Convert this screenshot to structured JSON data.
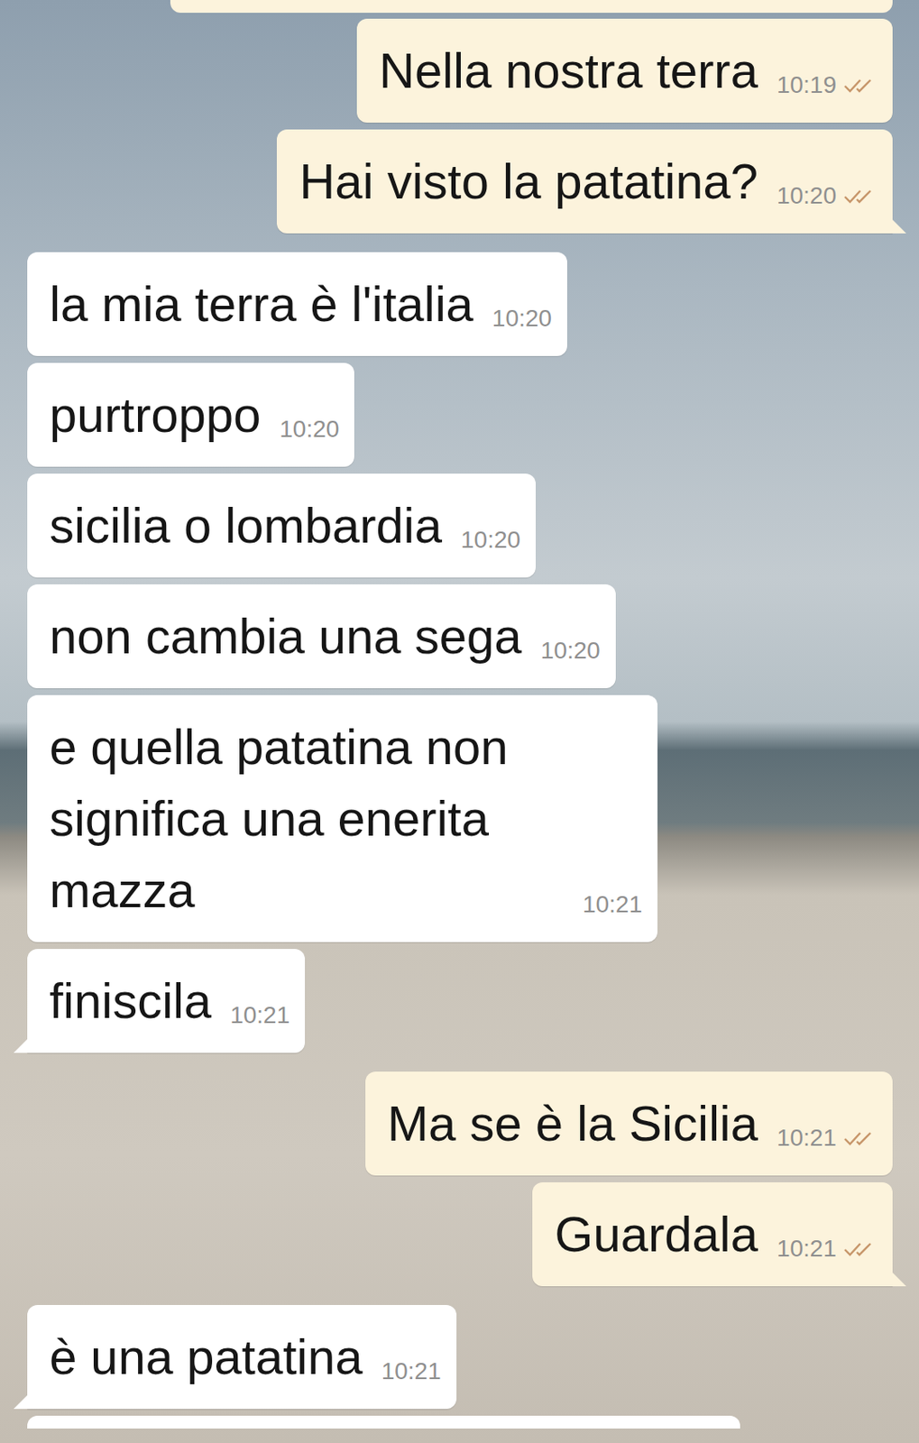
{
  "chat": {
    "messages": [
      {
        "from": "me",
        "text": "Nella nostra terra",
        "time": "10:19",
        "status": "delivered"
      },
      {
        "from": "me",
        "text": "Hai visto la patatina?",
        "time": "10:20",
        "status": "delivered"
      },
      {
        "from": "them",
        "text": "la mia terra è l'italia",
        "time": "10:20"
      },
      {
        "from": "them",
        "text": "purtroppo",
        "time": "10:20"
      },
      {
        "from": "them",
        "text": "sicilia o lombardia",
        "time": "10:20"
      },
      {
        "from": "them",
        "text": "non cambia una sega",
        "time": "10:20"
      },
      {
        "from": "them",
        "text": "e quella patatina non significa una enerita mazza",
        "time": "10:21"
      },
      {
        "from": "them",
        "text": "finiscila",
        "time": "10:21"
      },
      {
        "from": "me",
        "text": "Ma se è la Sicilia",
        "time": "10:21",
        "status": "delivered"
      },
      {
        "from": "me",
        "text": "Guardala",
        "time": "10:21",
        "status": "delivered"
      },
      {
        "from": "them",
        "text": "è una patatina",
        "time": "10:21"
      }
    ]
  }
}
